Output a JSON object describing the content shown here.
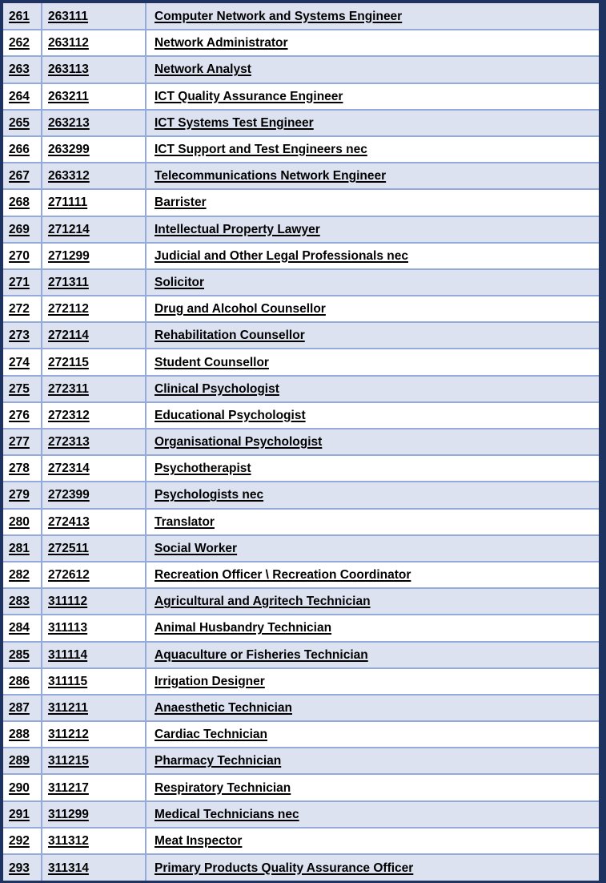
{
  "table": {
    "colors": {
      "frame": "#1f3360",
      "grid_line": "#93aada",
      "row_shaded": "#dce2f0",
      "row_plain": "#ffffff",
      "text": "#000000"
    },
    "columns": [
      "index",
      "code",
      "occupation"
    ],
    "rows": [
      {
        "index": "261",
        "code": "263111",
        "occupation": "Computer Network and Systems Engineer"
      },
      {
        "index": "262",
        "code": "263112",
        "occupation": "Network Administrator"
      },
      {
        "index": "263",
        "code": "263113",
        "occupation": "Network Analyst"
      },
      {
        "index": "264",
        "code": "263211",
        "occupation": "ICT Quality Assurance Engineer"
      },
      {
        "index": "265",
        "code": "263213",
        "occupation": "ICT Systems Test Engineer"
      },
      {
        "index": "266",
        "code": "263299",
        "occupation": "ICT Support and Test Engineers nec"
      },
      {
        "index": "267",
        "code": "263312",
        "occupation": "Telecommunications Network Engineer"
      },
      {
        "index": "268",
        "code": "271111",
        "occupation": "Barrister"
      },
      {
        "index": "269",
        "code": "271214",
        "occupation": "Intellectual Property Lawyer"
      },
      {
        "index": "270",
        "code": "271299",
        "occupation": "Judicial and Other Legal Professionals nec"
      },
      {
        "index": "271",
        "code": "271311",
        "occupation": "Solicitor"
      },
      {
        "index": "272",
        "code": "272112",
        "occupation": "Drug and Alcohol Counsellor"
      },
      {
        "index": "273",
        "code": "272114",
        "occupation": "Rehabilitation Counsellor"
      },
      {
        "index": "274",
        "code": "272115",
        "occupation": "Student Counsellor"
      },
      {
        "index": "275",
        "code": "272311",
        "occupation": "Clinical Psychologist"
      },
      {
        "index": "276",
        "code": "272312",
        "occupation": "Educational Psychologist"
      },
      {
        "index": "277",
        "code": "272313",
        "occupation": "Organisational Psychologist"
      },
      {
        "index": "278",
        "code": "272314",
        "occupation": "Psychotherapist"
      },
      {
        "index": "279",
        "code": "272399",
        "occupation": "Psychologists nec"
      },
      {
        "index": "280",
        "code": "272413",
        "occupation": "Translator"
      },
      {
        "index": "281",
        "code": "272511",
        "occupation": "Social Worker"
      },
      {
        "index": "282",
        "code": "272612",
        "occupation": "Recreation Officer \\ Recreation Coordinator"
      },
      {
        "index": "283",
        "code": "311112",
        "occupation": "Agricultural and Agritech Technician"
      },
      {
        "index": "284",
        "code": "311113",
        "occupation": "Animal Husbandry Technician"
      },
      {
        "index": "285",
        "code": "311114",
        "occupation": "Aquaculture or Fisheries Technician"
      },
      {
        "index": "286",
        "code": "311115",
        "occupation": "Irrigation Designer"
      },
      {
        "index": "287",
        "code": "311211",
        "occupation": "Anaesthetic Technician"
      },
      {
        "index": "288",
        "code": "311212",
        "occupation": "Cardiac Technician"
      },
      {
        "index": "289",
        "code": "311215",
        "occupation": "Pharmacy Technician"
      },
      {
        "index": "290",
        "code": "311217",
        "occupation": "Respiratory Technician"
      },
      {
        "index": "291",
        "code": "311299",
        "occupation": "Medical Technicians nec"
      },
      {
        "index": "292",
        "code": "311312",
        "occupation": "Meat Inspector"
      },
      {
        "index": "293",
        "code": "311314",
        "occupation": "Primary Products Quality Assurance Officer"
      }
    ]
  }
}
